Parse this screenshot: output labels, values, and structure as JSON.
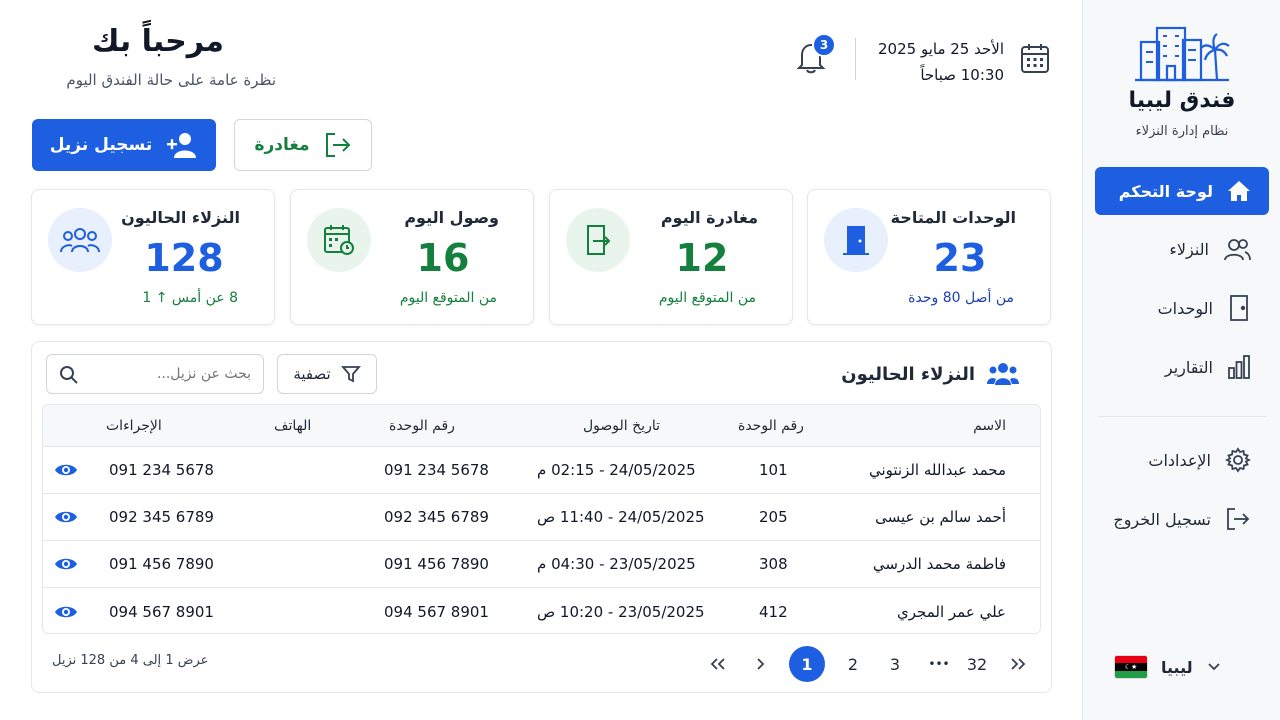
{
  "brand": {
    "name": "فندق ليبيا",
    "subtitle": "نظام إدارة النزلاء"
  },
  "nav": {
    "dashboard": "لوحة التحكم",
    "guests": "النزلاء",
    "units": "الوحدات",
    "reports": "التقارير",
    "settings": "الإعدادات",
    "logout": "تسجيل الخروج"
  },
  "language": {
    "label": "ليبيا"
  },
  "header": {
    "welcome": "مرحباً بك",
    "overview": "نظرة عامة على حالة الفندق اليوم",
    "date": "الأحد 25 مايو 2025",
    "time": "10:30 صباحاً",
    "notifications": "3"
  },
  "actions": {
    "checkin": "تسجيل نزيل",
    "checkout": "مغادرة"
  },
  "stats": {
    "available": {
      "title": "الوحدات المتاحة",
      "value": "23",
      "sub": "من أصل 80 وحدة"
    },
    "departures": {
      "title": "مغادرة اليوم",
      "value": "12",
      "sub": "من المتوقع اليوم"
    },
    "arrivals": {
      "title": "وصول اليوم",
      "value": "16",
      "sub": "من المتوقع اليوم"
    },
    "current": {
      "title": "النزلاء الحاليون",
      "value": "128",
      "sub": "8 عن أمس ↑ 1"
    }
  },
  "table": {
    "title": "النزلاء الحاليون",
    "filter": "تصفية",
    "search_placeholder": "بحث عن نزيل...",
    "headers": {
      "name": "الاسم",
      "unit": "رقم الوحدة",
      "arrival": "تاريخ الوصول",
      "unit2": "رقم الوحدة",
      "phone": "الهاتف",
      "actions": "الإجراءات"
    },
    "rows": [
      {
        "name": "محمد عبدالله الزنتوني",
        "unit": "101",
        "arrival": "24/05/2025 - 02:15 م",
        "unit2": "091 234 5678",
        "phone": "091 234 5678"
      },
      {
        "name": "أحمد سالم بن عيسى",
        "unit": "205",
        "arrival": "24/05/2025 - 11:40 ص",
        "unit2": "092 345 6789",
        "phone": "092 345 6789"
      },
      {
        "name": "فاطمة محمد الدرسي",
        "unit": "308",
        "arrival": "23/05/2025 - 04:30 م",
        "unit2": "091 456 7890",
        "phone": "091 456 7890"
      },
      {
        "name": "علي عمر المجري",
        "unit": "412",
        "arrival": "23/05/2025 - 10:20 ص",
        "unit2": "094 567 8901",
        "phone": "094 567 8901"
      }
    ],
    "summary": "عرض 1 إلى 4 من 128 نزيل"
  },
  "pagination": {
    "p1": "1",
    "p2": "2",
    "p3": "3",
    "ellipsis": "•••",
    "last": "32"
  },
  "colors": {
    "primary": "#1d5fe0",
    "success": "#15803d",
    "navy": "#1e40af"
  }
}
